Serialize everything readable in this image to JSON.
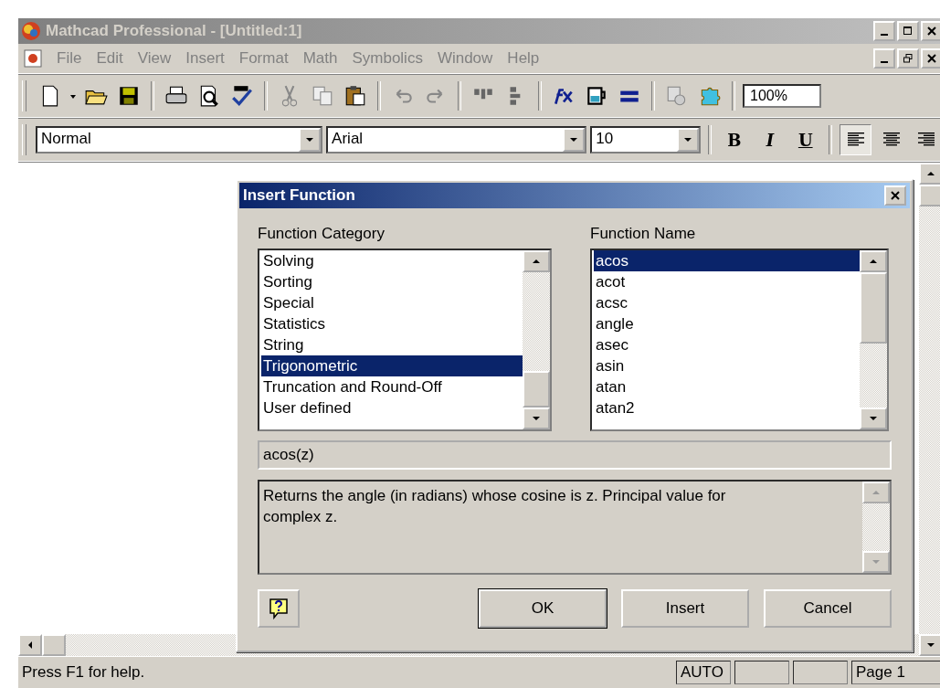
{
  "window": {
    "title": "Mathcad Professional - [Untitled:1]"
  },
  "menu": [
    "File",
    "Edit",
    "View",
    "Insert",
    "Format",
    "Math",
    "Symbolics",
    "Window",
    "Help"
  ],
  "toolbar": {
    "zoom": "100%"
  },
  "format_bar": {
    "style": "Normal",
    "font": "Arial",
    "size": "10",
    "bold": "B",
    "italic": "I",
    "underline": "U",
    "alignment": [
      {
        "selected": true
      },
      {
        "selected": false
      },
      {
        "selected": false
      }
    ]
  },
  "dialog": {
    "title": "Insert Function",
    "category_label": "Function Category",
    "name_label": "Function Name",
    "categories": [
      {
        "label": "Solving",
        "selected": false
      },
      {
        "label": "Sorting",
        "selected": false
      },
      {
        "label": "Special",
        "selected": false
      },
      {
        "label": "Statistics",
        "selected": false
      },
      {
        "label": "String",
        "selected": false
      },
      {
        "label": "Trigonometric",
        "selected": true
      },
      {
        "label": "Truncation and Round-Off",
        "selected": false
      },
      {
        "label": "User defined",
        "selected": false
      }
    ],
    "functions": [
      {
        "label": "acos",
        "selected": true
      },
      {
        "label": "acot",
        "selected": false
      },
      {
        "label": "acsc",
        "selected": false
      },
      {
        "label": "angle",
        "selected": false
      },
      {
        "label": "asec",
        "selected": false
      },
      {
        "label": "asin",
        "selected": false
      },
      {
        "label": "atan",
        "selected": false
      },
      {
        "label": "atan2",
        "selected": false
      }
    ],
    "syntax": "acos(z)",
    "description": "Returns the angle (in radians) whose cosine is z. Principal value for complex z.",
    "buttons": [
      "OK",
      "Insert",
      "Cancel"
    ]
  },
  "status_bar": {
    "message": "Press F1 for help.",
    "mode": "AUTO",
    "page": "Page 1"
  }
}
